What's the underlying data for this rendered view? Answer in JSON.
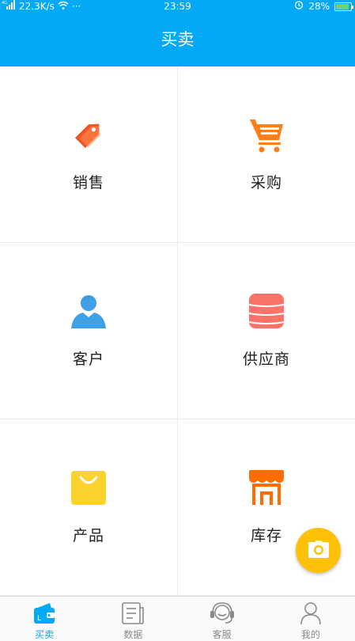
{
  "status_bar": {
    "signal": "4G",
    "speed": "22.3K/s",
    "dots": "···",
    "time": "23:59",
    "battery": "28%"
  },
  "header": {
    "title": "买卖"
  },
  "grid": [
    {
      "label": "销售",
      "icon": "price-tag-icon",
      "color": "#f4511e"
    },
    {
      "label": "采购",
      "icon": "shopping-cart-icon",
      "color": "#ff7f1a"
    },
    {
      "label": "客户",
      "icon": "user-icon",
      "color": "#3ea0e6"
    },
    {
      "label": "供应商",
      "icon": "database-icon",
      "color": "#fa7268"
    },
    {
      "label": "产品",
      "icon": "shopping-bag-icon",
      "color": "#fcd22c"
    },
    {
      "label": "库存",
      "icon": "store-icon",
      "color": "#ff6d00"
    }
  ],
  "fab": {
    "icon": "camera-icon",
    "color": "#ffc107"
  },
  "tabbar": [
    {
      "label": "买卖",
      "icon": "wallet-icon",
      "active": true
    },
    {
      "label": "数据",
      "icon": "document-icon",
      "active": false
    },
    {
      "label": "客服",
      "icon": "headset-icon",
      "active": false
    },
    {
      "label": "我的",
      "icon": "person-icon",
      "active": false
    }
  ],
  "colors": {
    "primary": "#03a9f4",
    "inactive": "#8a8a8a"
  }
}
